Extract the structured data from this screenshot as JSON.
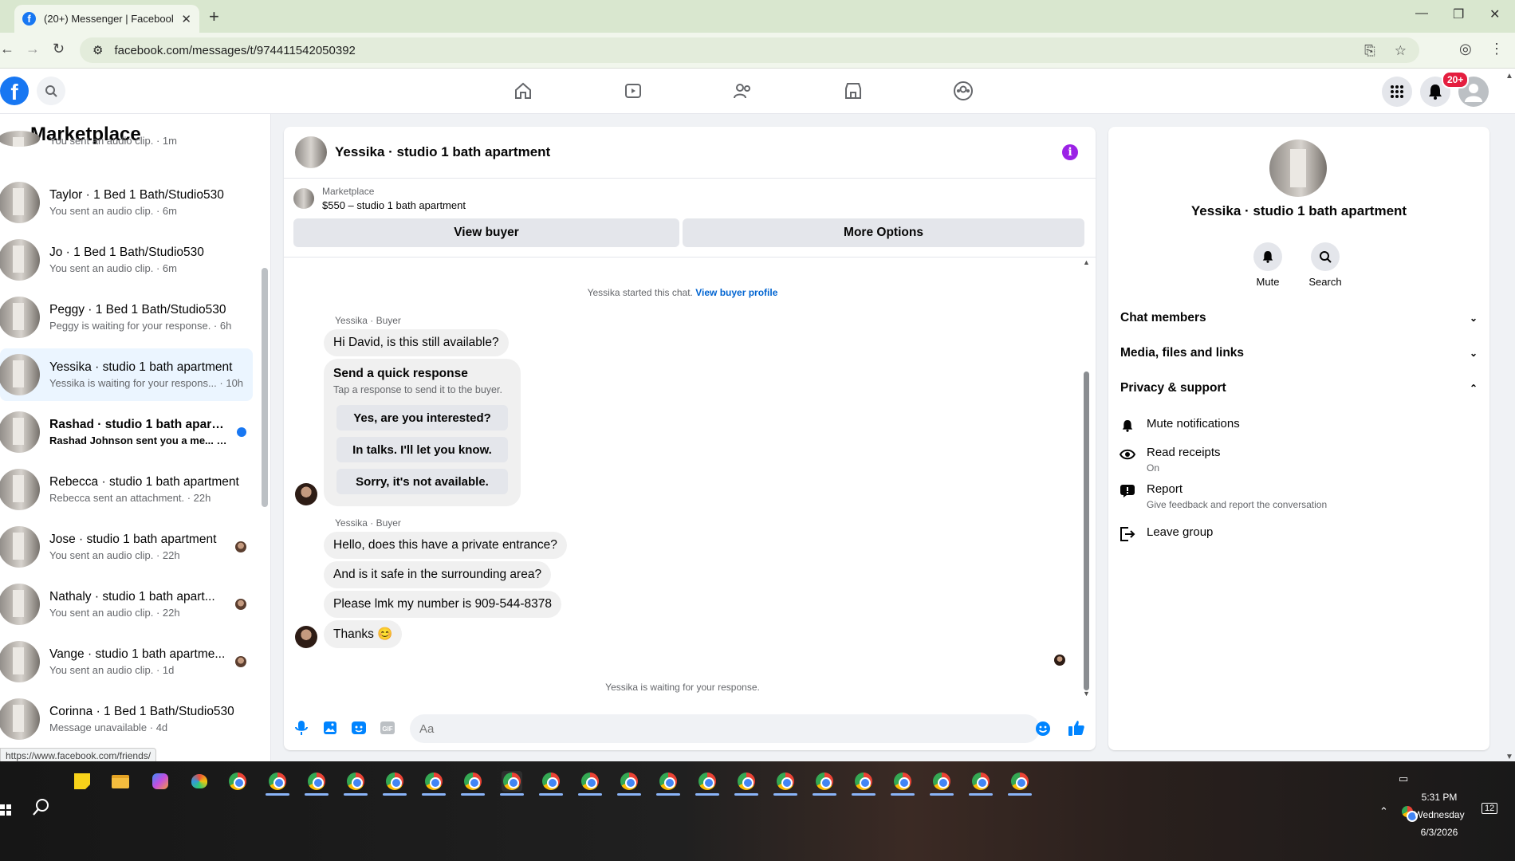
{
  "browser": {
    "tab_title": "(20+) Messenger | Facebook",
    "url": "facebook.com/messages/t/974411542050392",
    "status_url": "https://www.facebook.com/friends/"
  },
  "fb": {
    "logo": "f",
    "notification_badge": "20+",
    "nav_icons": [
      "home-icon",
      "video-icon",
      "friends-icon",
      "marketplace-icon",
      "groups-icon"
    ]
  },
  "left": {
    "title": "Marketplace",
    "partial_top": "You sent an audio clip. · 1m",
    "conversations": [
      {
        "name": "Taylor · 1 Bed 1 Bath/Studio530",
        "sub": "You sent an audio clip. · 6m"
      },
      {
        "name": "Jo · 1 Bed 1 Bath/Studio530",
        "sub": "You sent an audio clip. · 6m"
      },
      {
        "name": "Peggy · 1 Bed 1 Bath/Studio530",
        "sub": "Peggy is waiting for your response. · 6h"
      },
      {
        "name": "Yessika · studio 1 bath apartment",
        "sub": "Yessika is waiting for your respons... · 10h"
      },
      {
        "name": "Rashad · studio 1 bath apartm...",
        "sub": "Rashad Johnson sent you a me... · 10h"
      },
      {
        "name": "Rebecca · studio 1 bath apartment",
        "sub": "Rebecca sent an attachment. · 22h"
      },
      {
        "name": "Jose · studio 1 bath apartment",
        "sub": "You sent an audio clip. · 22h"
      },
      {
        "name": "Nathaly · studio 1 bath apart...",
        "sub": "You sent an audio clip. · 22h"
      },
      {
        "name": "Vange · studio 1 bath apartme...",
        "sub": "You sent an audio clip. · 1d"
      },
      {
        "name": "Corinna · 1 Bed 1 Bath/Studio530",
        "sub": "Message unavailable · 4d"
      }
    ]
  },
  "chat": {
    "title": "Yessika · studio 1 bath apartment",
    "marketplace_label": "Marketplace",
    "listing": "$550 – studio 1 bath apartment",
    "view_buyer": "View buyer",
    "more_options": "More Options",
    "started": "Yessika started this chat.",
    "view_buyer_profile": "View buyer profile",
    "sender_label": "Yessika · Buyer",
    "msg1": "Hi David, is this still available?",
    "quick_title": "Send a quick response",
    "quick_sub": "Tap a response to send it to the buyer.",
    "quick_replies": [
      "Yes, are you interested?",
      "In talks. I'll let you know.",
      "Sorry, it's not available."
    ],
    "sender_label2": "Yessika · Buyer",
    "msg2": "Hello, does this have a private entrance?",
    "msg3": "And is it safe in the surrounding area?",
    "msg4": "Please lmk my number is 909-544-8378",
    "msg5": "Thanks 😊",
    "waiting": "Yessika is waiting for your response.",
    "input_placeholder": "Aa"
  },
  "right": {
    "title": "Yessika · studio 1 bath apartment",
    "mute": "Mute",
    "search": "Search",
    "chat_members": "Chat members",
    "media": "Media, files and links",
    "privacy": "Privacy & support",
    "mute_notifications": "Mute notifications",
    "read_receipts": "Read receipts",
    "read_receipts_state": "On",
    "report": "Report",
    "report_sub": "Give feedback and report the conversation",
    "leave_group": "Leave group"
  },
  "taskbar": {
    "time": "5:31 PM",
    "day": "Wednesday",
    "date": "6/3/2026",
    "notif_count": "12"
  },
  "colors": {
    "fb_blue": "#1877f2",
    "link_blue": "#0064d1",
    "active_bg": "#ebf5ff",
    "info_purple": "#9b22e6",
    "badge_red": "#e41e3f"
  }
}
